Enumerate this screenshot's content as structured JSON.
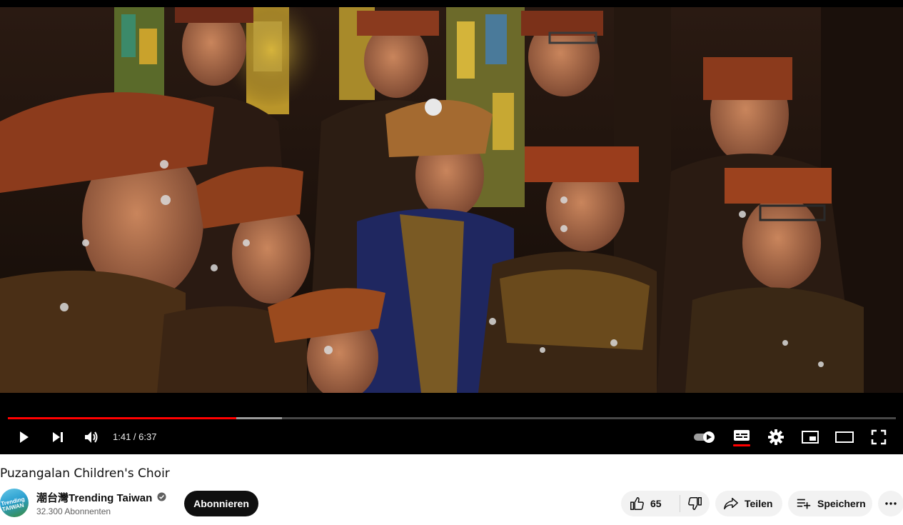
{
  "player": {
    "time_current": "1:41",
    "time_separator": " / ",
    "time_total": "6:37",
    "progress_played_fraction": 0.257,
    "progress_buffered_fraction": 0.309,
    "autoplay_on": true,
    "subtitles_active": true,
    "controls": [
      "play-icon",
      "next-icon",
      "volume-icon",
      "autoplay-toggle",
      "subtitles-icon",
      "settings-icon",
      "miniplayer-icon",
      "theater-icon",
      "fullscreen-icon"
    ],
    "accent_color": "#ff0000"
  },
  "video": {
    "title": "Puzangalan Children's Choir"
  },
  "channel": {
    "name": "潮台灣Trending Taiwan",
    "subscribers": "32.300 Abonnenten",
    "verified": true,
    "avatar_text": "Trending TAIWAN"
  },
  "actions": {
    "subscribe_label": "Abonnieren",
    "like_count": "65",
    "share_label": "Teilen",
    "save_label": "Speichern"
  }
}
